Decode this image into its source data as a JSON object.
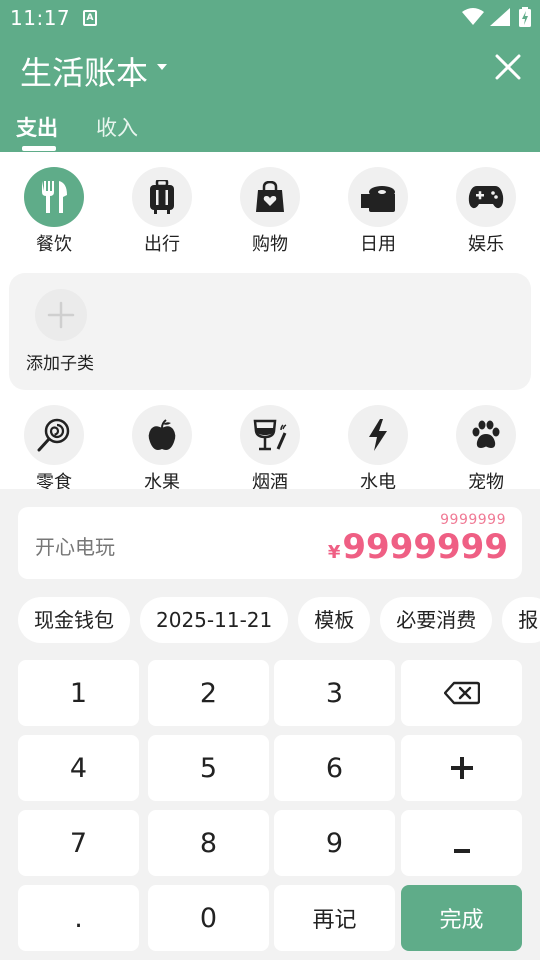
{
  "status_bar": {
    "time": "11:17",
    "notification_icon": "A"
  },
  "header": {
    "title": "生活账本",
    "tabs": [
      "支出",
      "收入"
    ]
  },
  "categories": [
    "餐饮",
    "出行",
    "购物",
    "日用",
    "娱乐"
  ],
  "categories_row2": [
    "零食",
    "水果",
    "烟酒",
    "水电",
    "宠物"
  ],
  "subcategory": {
    "add_label": "添加子类"
  },
  "entry": {
    "note": "开心电玩",
    "amount_small": "9999999",
    "currency": "¥",
    "amount": "9999999"
  },
  "chips": [
    "现金钱包",
    "2025-11-21",
    "模板",
    "必要消费",
    "报"
  ],
  "keypad": {
    "k1": "1",
    "k2": "2",
    "k3": "3",
    "k4": "4",
    "k5": "5",
    "k6": "6",
    "k7": "7",
    "k8": "8",
    "k9": "9",
    "dot": ".",
    "k0": "0",
    "again": "再记",
    "done": "完成"
  },
  "colors": {
    "primary": "#5fac89",
    "amount": "#ef5f84",
    "amount_small": "#f07a95"
  }
}
